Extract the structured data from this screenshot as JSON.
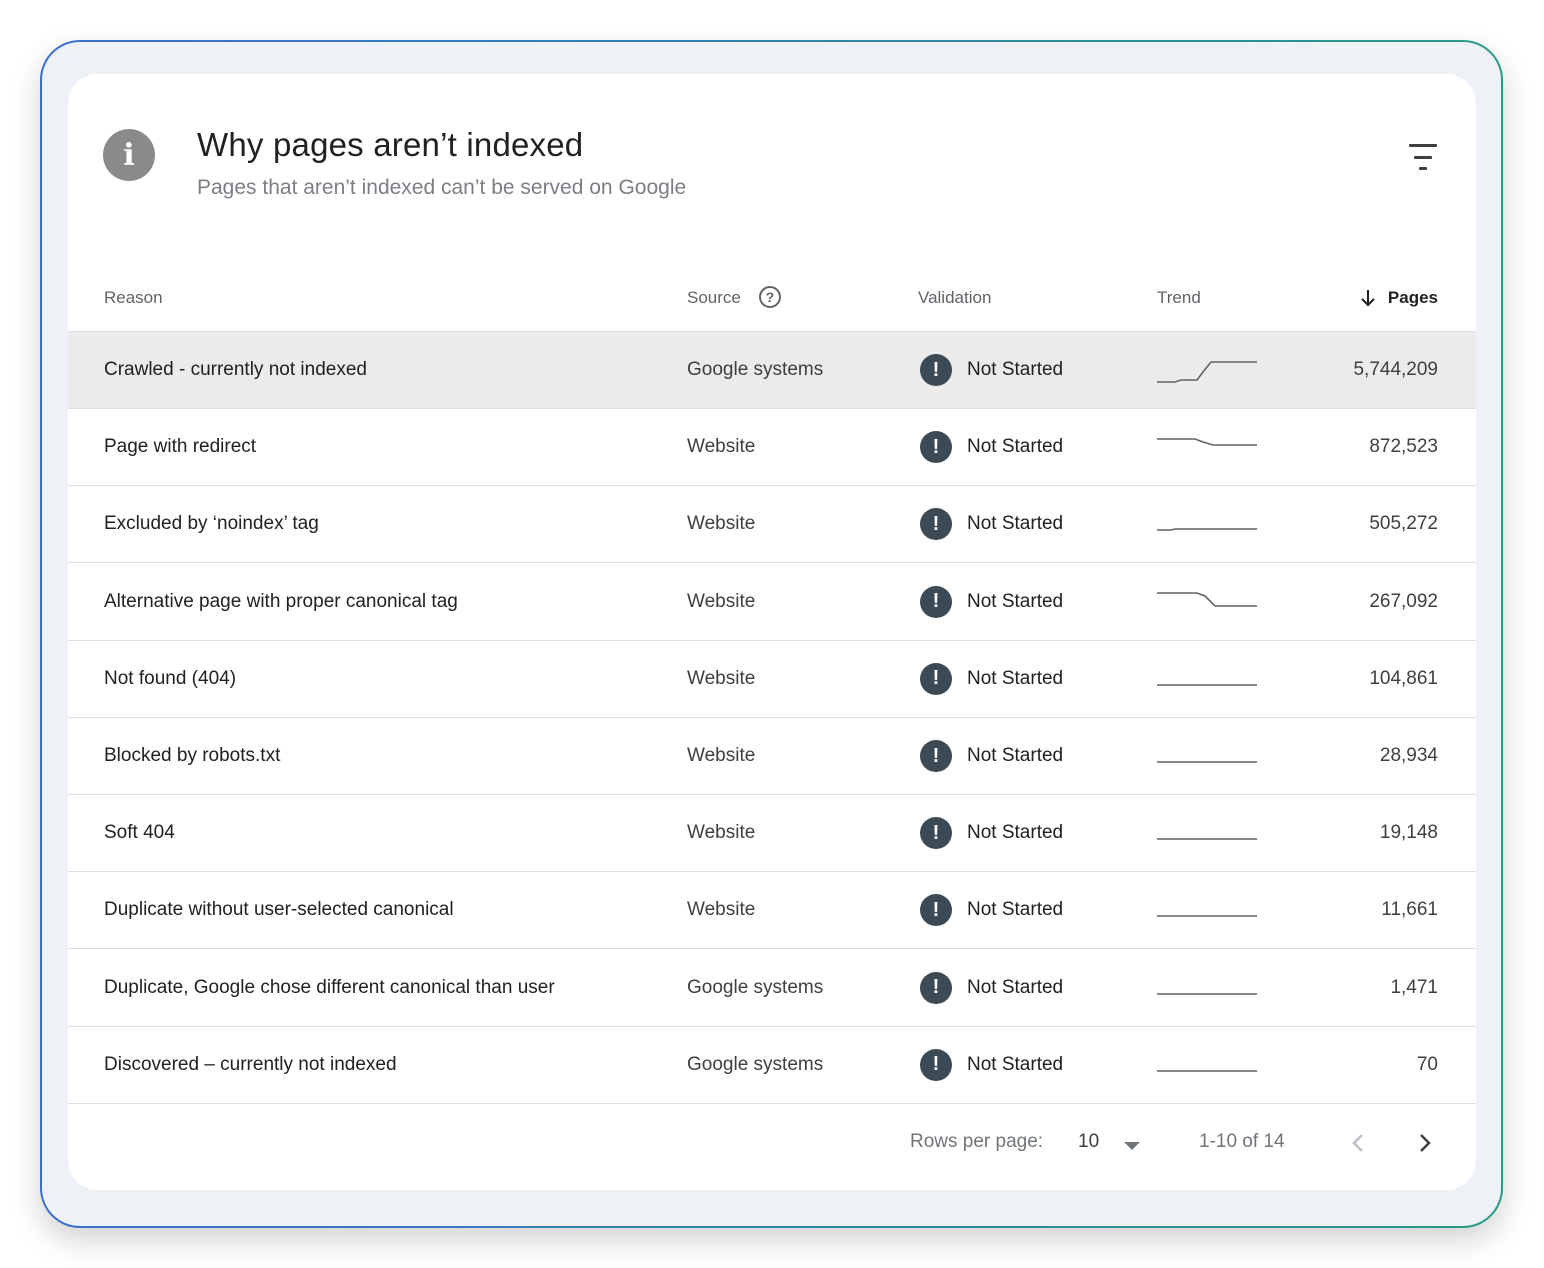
{
  "header": {
    "info_icon_glyph": "i",
    "title": "Why pages aren’t indexed",
    "subtitle": "Pages that aren’t indexed can’t be served on Google"
  },
  "columns": {
    "reason": "Reason",
    "source": "Source",
    "validation": "Validation",
    "trend": "Trend",
    "pages": "Pages"
  },
  "rows": [
    {
      "reason": "Crawled - currently not indexed",
      "source": "Google systems",
      "validation": "Not Started",
      "pages": "5,744,209",
      "trend": "step-up",
      "highlighted": true
    },
    {
      "reason": "Page with redirect",
      "source": "Website",
      "validation": "Not Started",
      "pages": "872,523",
      "trend": "small-step-down"
    },
    {
      "reason": "Excluded by ‘noindex’ tag",
      "source": "Website",
      "validation": "Not Started",
      "pages": "505,272",
      "trend": "flat-slight-rise"
    },
    {
      "reason": "Alternative page with proper canonical tag",
      "source": "Website",
      "validation": "Not Started",
      "pages": "267,092",
      "trend": "step-down"
    },
    {
      "reason": "Not found (404)",
      "source": "Website",
      "validation": "Not Started",
      "pages": "104,861",
      "trend": "flat"
    },
    {
      "reason": "Blocked by robots.txt",
      "source": "Website",
      "validation": "Not Started",
      "pages": "28,934",
      "trend": "flat"
    },
    {
      "reason": "Soft 404",
      "source": "Website",
      "validation": "Not Started",
      "pages": "19,148",
      "trend": "flat"
    },
    {
      "reason": "Duplicate without user-selected canonical",
      "source": "Website",
      "validation": "Not Started",
      "pages": "11,661",
      "trend": "flat"
    },
    {
      "reason": "Duplicate, Google chose different canonical than user",
      "source": "Google systems",
      "validation": "Not Started",
      "pages": "1,471",
      "trend": "flat"
    },
    {
      "reason": "Discovered – currently not indexed",
      "source": "Google systems",
      "validation": "Not Started",
      "pages": "70",
      "trend": "flat"
    }
  ],
  "footer": {
    "rows_per_page_label": "Rows per page:",
    "rows_per_page_value": "10",
    "range": "1-10 of 14"
  },
  "icons": {
    "header": "info-icon",
    "filter": "filter-icon",
    "source_help": "help-circle-icon",
    "sort": "arrow-down-icon",
    "validation": "alert-circle-icon",
    "prev": "chevron-left-icon",
    "next": "chevron-right-icon"
  },
  "colors": {
    "frame_border_start": "#3a6fd0",
    "frame_border_end": "#2a9a86",
    "alert_icon": "#3c4a55",
    "highlight_row": "#ebebeb"
  }
}
